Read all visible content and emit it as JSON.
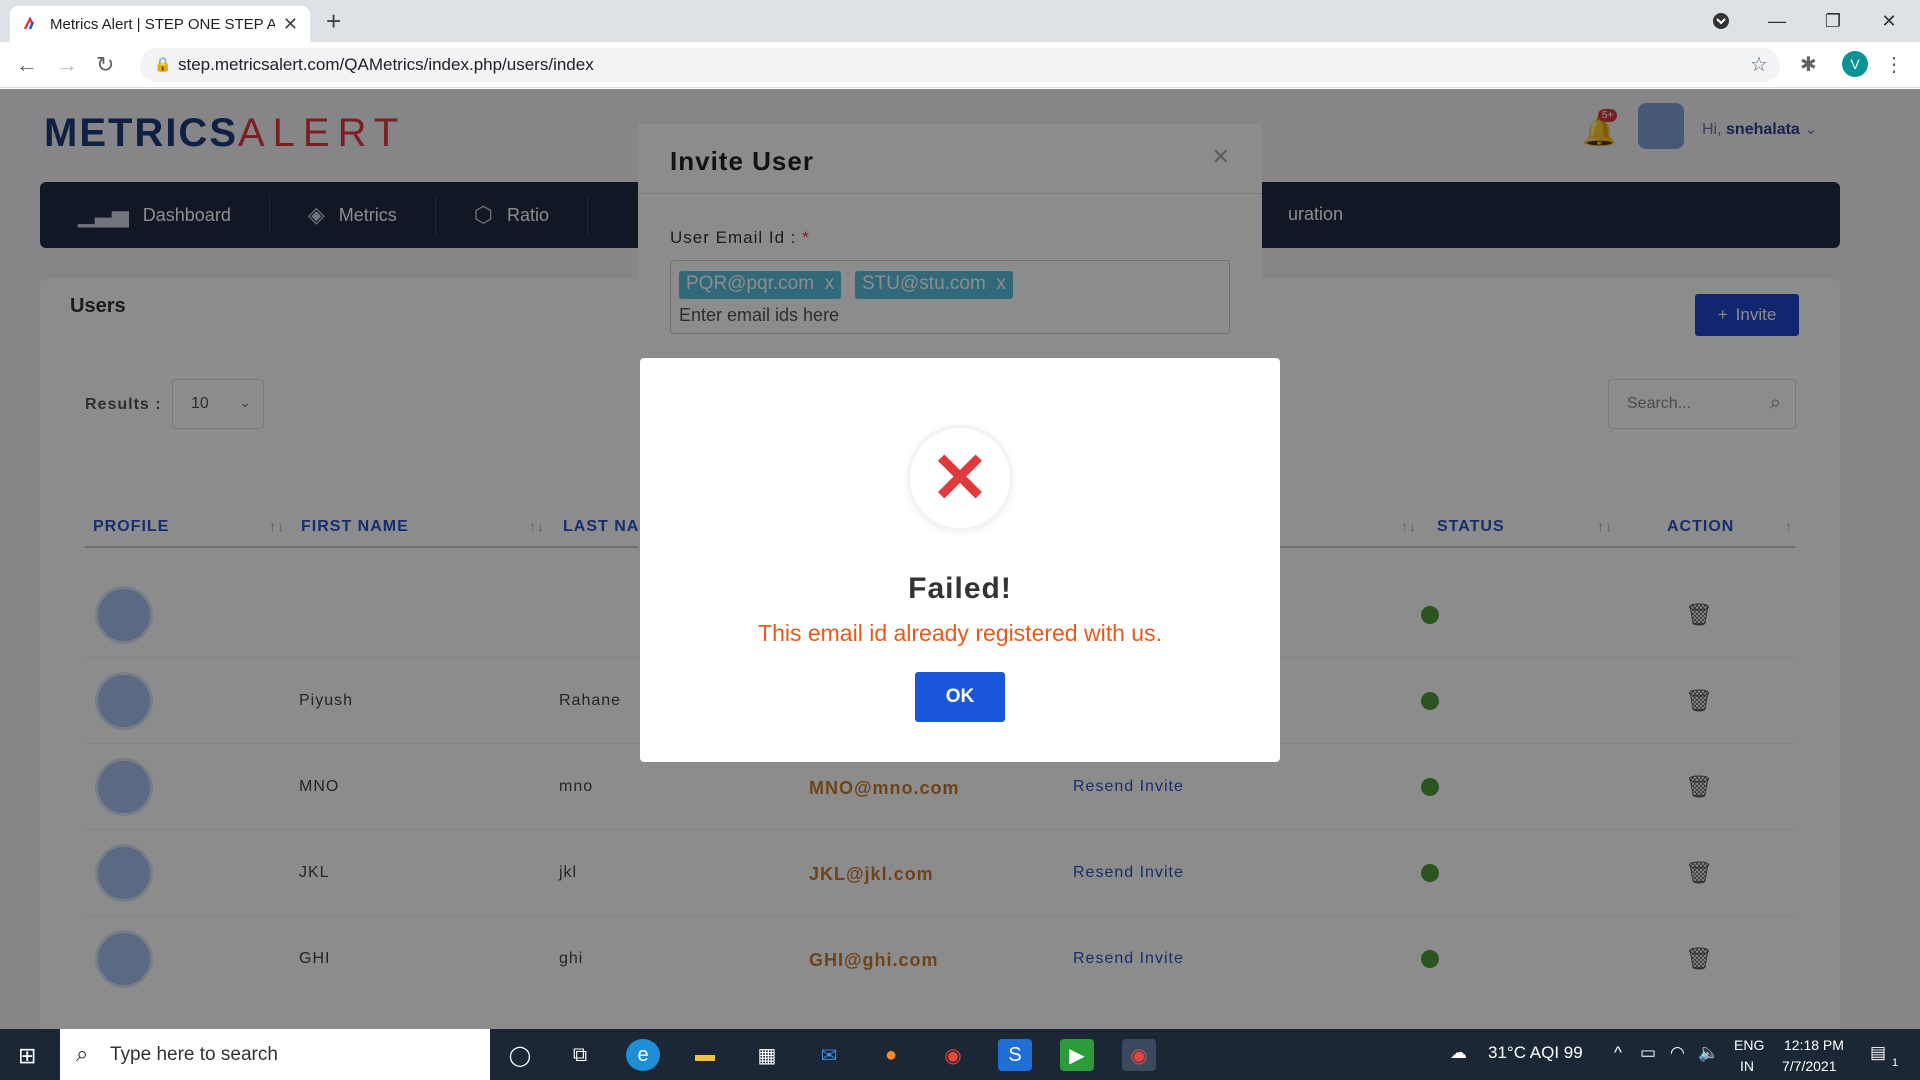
{
  "browser": {
    "tab_title": "Metrics Alert | STEP ONE STEP AH",
    "url": "step.metricsalert.com/QAMetrics/index.php/users/index",
    "profile_initial": "V"
  },
  "header": {
    "logo_part1": "METRICS",
    "logo_part2": "ALERT",
    "notif_badge": "5+",
    "greeting": "Hi,",
    "user_name": "snehalata"
  },
  "nav": {
    "items": [
      {
        "label": "Dashboard",
        "icon": "bar-chart-icon"
      },
      {
        "label": "Metrics",
        "icon": "layers-icon"
      },
      {
        "label": "Ratio",
        "icon": "cube-icon"
      }
    ],
    "tail_label": "uration"
  },
  "users": {
    "title": "Users",
    "invite_label": "Invite",
    "results_label": "Results :",
    "results_value": "10",
    "search_placeholder": "Search...",
    "columns": [
      "PROFILE",
      "FIRST NAME",
      "LAST NA",
      "STATUS",
      "ACTION"
    ],
    "rows": [
      {
        "first": "",
        "last": "",
        "email": "",
        "resend": ""
      },
      {
        "first": "Piyush",
        "last": "Rahane",
        "email": "",
        "resend": ""
      },
      {
        "first": "MNO",
        "last": "mno",
        "email": "MNO@mno.com",
        "resend": "Resend Invite"
      },
      {
        "first": "JKL",
        "last": "jkl",
        "email": "JKL@jkl.com",
        "resend": "Resend Invite"
      },
      {
        "first": "GHI",
        "last": "ghi",
        "email": "GHI@ghi.com",
        "resend": "Resend Invite"
      }
    ]
  },
  "invite_modal": {
    "title": "Invite User",
    "email_label": "User Email Id :",
    "required_mark": "*",
    "tags": [
      "PQR@pqr.com",
      "STU@stu.com"
    ],
    "tag_remove": "x",
    "input_placeholder": "Enter email ids here"
  },
  "alert": {
    "title": "Failed!",
    "message": "This email id already registered with us.",
    "ok_label": "OK"
  },
  "taskbar": {
    "search_placeholder": "Type here to search",
    "weather": "31°C  AQI 99",
    "lang1": "ENG",
    "lang2": "IN",
    "time": "12:18 PM",
    "date": "7/7/2021",
    "notif_count": "1"
  },
  "colors": {
    "accent": "#1f45c8",
    "error": "#e85a1c",
    "status_active": "#4f9a3c"
  }
}
